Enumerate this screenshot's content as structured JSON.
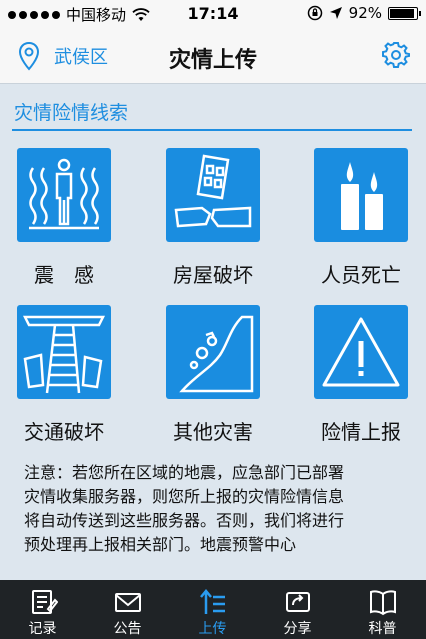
{
  "status_bar": {
    "carrier": "中国移动",
    "time": "17:14",
    "battery": "92%",
    "battery_level": 0.92
  },
  "header": {
    "location": "武侯区",
    "title": "灾情上传"
  },
  "section": {
    "title": "灾情险情线索"
  },
  "tiles": [
    {
      "label": "震　感",
      "icon": "shaking-person-icon"
    },
    {
      "label": "房屋破坏",
      "icon": "collapsed-house-icon"
    },
    {
      "label": "人员死亡",
      "icon": "candles-icon"
    },
    {
      "label": "交通破坏",
      "icon": "broken-railway-icon"
    },
    {
      "label": "其他灾害",
      "icon": "landslide-icon"
    },
    {
      "label": "险情上报",
      "icon": "warning-triangle-icon"
    }
  ],
  "notice": {
    "line1": "注意：若您所在区域的地震，应急部门已部署",
    "line2": "灾情收集服务器，则您所上报的灾情险情信息",
    "line3": "将自动传送到这些服务器。否则，我们将进行",
    "line4": "预处理再上报相关部门。地震预警中心"
  },
  "tabbar": {
    "tabs": [
      {
        "label": "记录",
        "icon": "record-icon"
      },
      {
        "label": "公告",
        "icon": "mail-icon"
      },
      {
        "label": "上传",
        "icon": "upload-icon",
        "active": true
      },
      {
        "label": "分享",
        "icon": "share-icon"
      },
      {
        "label": "科普",
        "icon": "book-icon"
      }
    ]
  },
  "colors": {
    "accent": "#1e8ee0",
    "tile": "#1a8de0",
    "background": "#dde6ee",
    "tabbar": "#1f2326",
    "tab_active": "#2a9cf0"
  }
}
